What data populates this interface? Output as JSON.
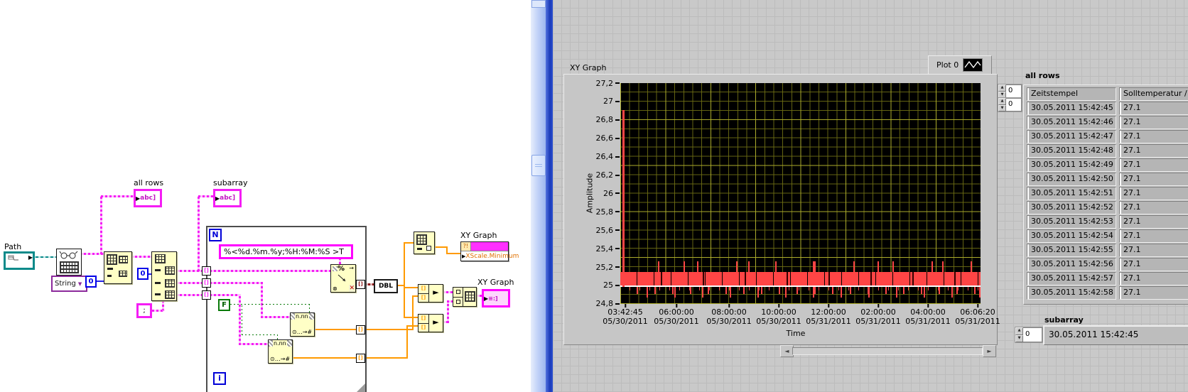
{
  "icons": {
    "up": "▲",
    "down": "▼",
    "left_arrow": "◄",
    "right_arrow": "►",
    "combo_arrow": "▼",
    "terminal_arrow": "▶",
    "tunnel": "[]",
    "percent": "%",
    "arrow_right": "→",
    "cross": "✕",
    "circled_dot": "⊗",
    "num_glyph": "⊙…→#",
    "bundle_arrow": "►",
    "string_glyph": "abc]",
    "cluster_glyph": "≡:]",
    "qmarks": "?!"
  },
  "block_diagram": {
    "path_label": "Path",
    "all_rows_label": "all rows",
    "subarray_label": "subarray",
    "string_selector": "String",
    "const_zero_1": "0",
    "const_zero_2": "0",
    "delimiter_const": ";",
    "loop_count": "N",
    "loop_iter": "i",
    "bool_const": "F",
    "format_string": "%<%d.%m.%y;%H:%M:%S >T",
    "dbl_label": "DBL",
    "string_to_num_label": "n.nn",
    "property_node": {
      "title": "XY Graph",
      "property": "XScale.Minimum"
    },
    "xy_graph_terminal_label": "XY Graph"
  },
  "front_panel": {
    "graph": {
      "title": "XY Graph",
      "legend": "Plot 0",
      "ylabel": "Amplitude",
      "xlabel": "Time",
      "y_ticks": [
        "27,2",
        "27",
        "26,8",
        "26,6",
        "26,4",
        "26,2",
        "26",
        "25,8",
        "25,6",
        "25,4",
        "25,2",
        "25",
        "24,8"
      ],
      "x_ticks": [
        {
          "time": "03:42:45",
          "date": "05/30/2011"
        },
        {
          "time": "06:00:00",
          "date": "05/30/2011"
        },
        {
          "time": "08:00:00",
          "date": "05/30/2011"
        },
        {
          "time": "10:00:00",
          "date": "05/30/2011"
        },
        {
          "time": "12:00:00",
          "date": "05/31/2011"
        },
        {
          "time": "02:00:00",
          "date": "05/31/2011"
        },
        {
          "time": "04:00:00",
          "date": "05/31/2011"
        },
        {
          "time": "06:06:20",
          "date": "05/31/2011"
        }
      ]
    },
    "table": {
      "title": "all rows",
      "index_values": [
        "0",
        "0"
      ],
      "headers": [
        "Zeitstempel",
        "Solltemperatur / °C"
      ],
      "rows": [
        [
          "30.05.2011 15:42:45",
          "27.1"
        ],
        [
          "30.05.2011 15:42:46",
          "27.1"
        ],
        [
          "30.05.2011 15:42:47",
          "27.1"
        ],
        [
          "30.05.2011 15:42:48",
          "27.1"
        ],
        [
          "30.05.2011 15:42:49",
          "27.1"
        ],
        [
          "30.05.2011 15:42:50",
          "27.1"
        ],
        [
          "30.05.2011 15:42:51",
          "27.1"
        ],
        [
          "30.05.2011 15:42:52",
          "27.1"
        ],
        [
          "30.05.2011 15:42:53",
          "27.1"
        ],
        [
          "30.05.2011 15:42:54",
          "27.1"
        ],
        [
          "30.05.2011 15:42:55",
          "27.1"
        ],
        [
          "30.05.2011 15:42:56",
          "27.1"
        ],
        [
          "30.05.2011 15:42:57",
          "27.1"
        ],
        [
          "30.05.2011 15:42:58",
          "27.1"
        ]
      ]
    },
    "subarray": {
      "label": "subarray",
      "index": "0",
      "value": "30.05.2011 15:42:45"
    }
  },
  "chart_data": {
    "type": "line",
    "title": "XY Graph",
    "xlabel": "Time",
    "ylabel": "Amplitude",
    "ylim": [
      24.8,
      27.2
    ],
    "y_tick_values": [
      24.8,
      25.0,
      25.2,
      25.4,
      25.6,
      25.8,
      26.0,
      26.2,
      26.4,
      26.6,
      26.8,
      27.0,
      27.2
    ],
    "x_tick_labels": [
      "03:42:45 05/30/2011",
      "06:00:00 05/30/2011",
      "08:00:00 05/30/2011",
      "10:00:00 05/30/2011",
      "12:00:00 05/31/2011",
      "02:00:00 05/31/2011",
      "04:00:00 05/31/2011",
      "06:06:20 05/31/2011"
    ],
    "legend": [
      "Plot 0"
    ],
    "legend_position": "top-right",
    "grid": true,
    "plot_bg": "#000000",
    "grid_color": "#6e6e14",
    "series": [
      {
        "name": "Plot 0",
        "color": "#ff4545",
        "description": "Dense noisy temperature band oscillating between ~25.0 and ~25.15 across the full time range, with frequent downward spikes to ~24.87, a constant white line at 25.0, and an initial spike up to ~26.9 at the first sample.",
        "points": [
          [
            "03:42:45 05/30/2011",
            26.9
          ],
          [
            "03:43:00 05/30/2011",
            25.1
          ],
          [
            "06:00:00 05/30/2011",
            25.05
          ],
          [
            "12:00:00 05/30/2011",
            25.12
          ],
          [
            "12:00:00 05/31/2011",
            25.08
          ],
          [
            "04:00:00 05/31/2011",
            25.1
          ],
          [
            "06:06:20 05/31/2011",
            25.05
          ]
        ]
      }
    ]
  }
}
